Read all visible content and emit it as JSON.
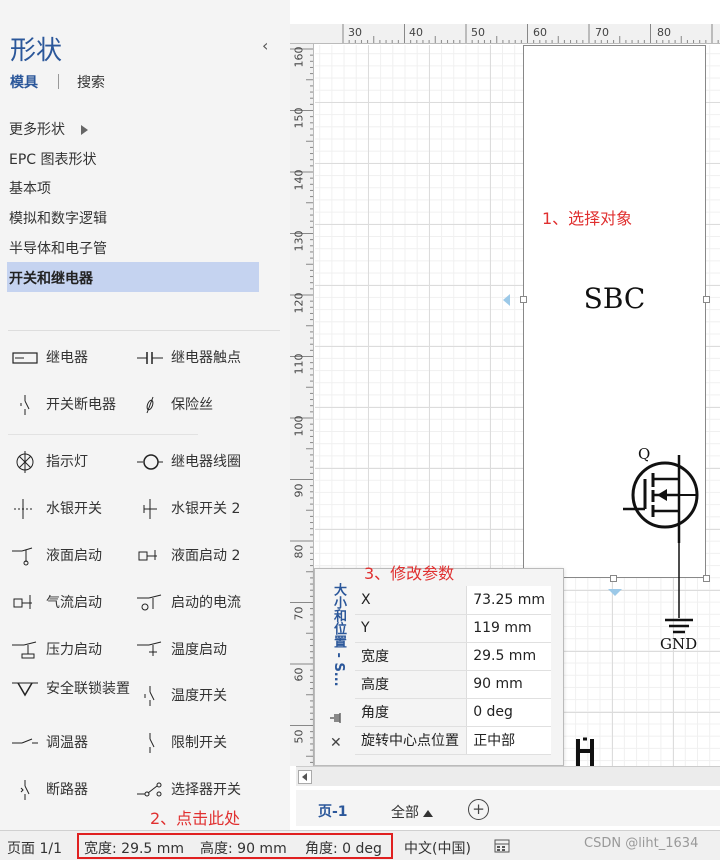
{
  "shapes_pane": {
    "title": "形状",
    "tabs": {
      "stencils": "模具",
      "search": "搜索"
    },
    "categories": [
      {
        "label": "更多形状"
      },
      {
        "label": "EPC 图表形状"
      },
      {
        "label": "基本项"
      },
      {
        "label": "模拟和数字逻辑"
      },
      {
        "label": "半导体和电子管"
      },
      {
        "label": "开关和继电器"
      }
    ],
    "shapes": [
      {
        "label": "继电器",
        "icon": "relay-icon"
      },
      {
        "label": "继电器触点",
        "icon": "relay-contact-icon"
      },
      {
        "label": "开关断电器",
        "icon": "switch-breaker-icon"
      },
      {
        "label": "保险丝",
        "icon": "fuse-icon"
      },
      {
        "label": "指示灯",
        "icon": "indicator-lamp-icon"
      },
      {
        "label": "继电器线圈",
        "icon": "relay-coil-icon"
      },
      {
        "label": "水银开关",
        "icon": "mercury-switch-icon"
      },
      {
        "label": "水银开关 2",
        "icon": "mercury-switch-2-icon"
      },
      {
        "label": "液面启动",
        "icon": "liquid-level-icon"
      },
      {
        "label": "液面启动 2",
        "icon": "liquid-level-2-icon"
      },
      {
        "label": "气流启动",
        "icon": "airflow-icon"
      },
      {
        "label": "启动的电流",
        "icon": "current-actuated-icon"
      },
      {
        "label": "压力启动",
        "icon": "pressure-icon"
      },
      {
        "label": "温度启动",
        "icon": "temperature-icon"
      },
      {
        "label": "安全联锁装置",
        "icon": "safety-interlock-icon"
      },
      {
        "label": "温度开关",
        "icon": "temperature-switch-icon"
      },
      {
        "label": "调温器",
        "icon": "thermostat-icon"
      },
      {
        "label": "限制开关",
        "icon": "limit-switch-icon"
      },
      {
        "label": "断路器",
        "icon": "circuit-breaker-icon"
      },
      {
        "label": "选择器开关",
        "icon": "selector-switch-icon"
      }
    ]
  },
  "rulers": {
    "top": [
      "30",
      "40",
      "50",
      "60",
      "70",
      "80"
    ],
    "left": [
      "160",
      "150",
      "140",
      "130",
      "120",
      "110",
      "100",
      "90",
      "80",
      "70",
      "60",
      "50"
    ]
  },
  "canvas": {
    "block_label": "SBC",
    "mosfet_label": "Q",
    "gnd_label": "GND",
    "annotation_1": "1、选择对象",
    "annotation_2": "2、点击此处",
    "annotation_3": "3、修改参数"
  },
  "size_window": {
    "title": "大小和位置 - S...",
    "rows": [
      {
        "name": "X",
        "value": "73.25 mm"
      },
      {
        "name": "Y",
        "value": "119 mm"
      },
      {
        "name": "宽度",
        "value": "29.5 mm"
      },
      {
        "name": "高度",
        "value": "90 mm"
      },
      {
        "name": "角度",
        "value": "0 deg"
      },
      {
        "name": "旋转中心点位置",
        "value": "正中部"
      }
    ]
  },
  "page_tabs": {
    "page1": "页-1",
    "all": "全部"
  },
  "status_bar": {
    "page": "页面 1/1",
    "width": "宽度: 29.5 mm",
    "height": "高度: 90 mm",
    "angle": "角度: 0 deg",
    "language": "中文(中国)",
    "watermark": "CSDN @liht_1634"
  },
  "colors": {
    "accent": "#2b579a",
    "annotation": "#e03030",
    "highlight": "#c5d3f0"
  }
}
